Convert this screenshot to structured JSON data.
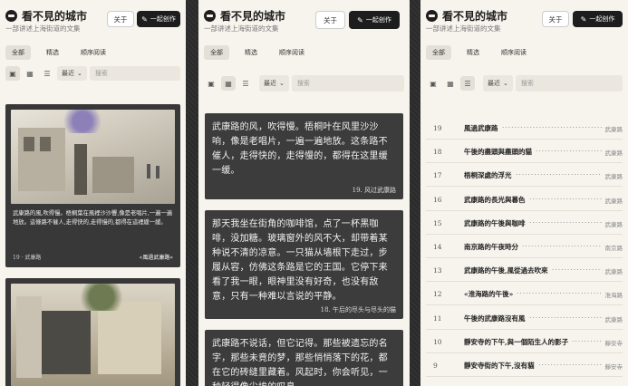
{
  "app": {
    "title": "看不見的城市",
    "subtitle": "一部讲述上海街道的文集",
    "about_label": "关于",
    "create_label": "一起创作"
  },
  "tabs": [
    "全部",
    "精选",
    "顺序阅读"
  ],
  "sort_label": "最近",
  "search_placeholder": "搜索",
  "panel1": {
    "cards": [
      {
        "text": "武康路的風,吹得慢。梧桐葉在風裡沙沙響,像是老唱片,一遍一遍地放。這條路不催人,走得快的,走得慢的,都得在這裡緩一緩。",
        "number": "19 · 武康路",
        "title": "«風過武康路»"
      }
    ]
  },
  "panel2": {
    "cards": [
      {
        "text": "武康路的风，吹得慢。梧桐叶在风里沙沙响，像是老唱片，一遍一遍地放。这条路不催人，走得快的，走得慢的，都得在这里缓一缓。",
        "foot": "19. 风过武康路"
      },
      {
        "text": "那天我坐在街角的咖啡馆，点了一杯黑咖啡，没加糖。玻璃窗外的风不大，却带着某种说不清的凉意。一只猫从墙根下走过，步履从容，仿佛这条路是它的王国。它停下来看了我一眼，眼神里没有好奇，也没有敌意，只有一种难以言说的平静。",
        "foot": "18. 午后的尽头与尽头的猫"
      },
      {
        "text": "武康路不说话，但它记得。那些被遗忘的名字，那些未竟的梦，那些悄悄落下的花，都在它的砖缝里藏着。风起时，你会听见，一种轻得像尘埃的叹息。"
      }
    ]
  },
  "panel3": {
    "rows": [
      {
        "num": "19",
        "title": "風過武康路",
        "street": "武康路"
      },
      {
        "num": "18",
        "title": "午後的盡頭與盡頭的貓",
        "street": "武康路"
      },
      {
        "num": "17",
        "title": "梧桐深處的浮光",
        "street": "武康路"
      },
      {
        "num": "16",
        "title": "武康路的長光與暮色",
        "street": "武康路"
      },
      {
        "num": "15",
        "title": "武康路的午後與咖啡",
        "street": "武康路"
      },
      {
        "num": "14",
        "title": "南京路的午夜時分",
        "street": "南京路"
      },
      {
        "num": "13",
        "title": "武康路的午後,風從過去吹來",
        "street": "武康路"
      },
      {
        "num": "12",
        "title": "«淮海路的午後»",
        "street": "淮海路"
      },
      {
        "num": "11",
        "title": "午後的武康路沒有風",
        "street": "武康路"
      },
      {
        "num": "10",
        "title": "靜安寺的下午,與一個陌生人的影子",
        "street": "靜安寺"
      },
      {
        "num": "9",
        "title": "靜安寺街的下午,沒有貓",
        "street": "靜安寺"
      }
    ]
  }
}
